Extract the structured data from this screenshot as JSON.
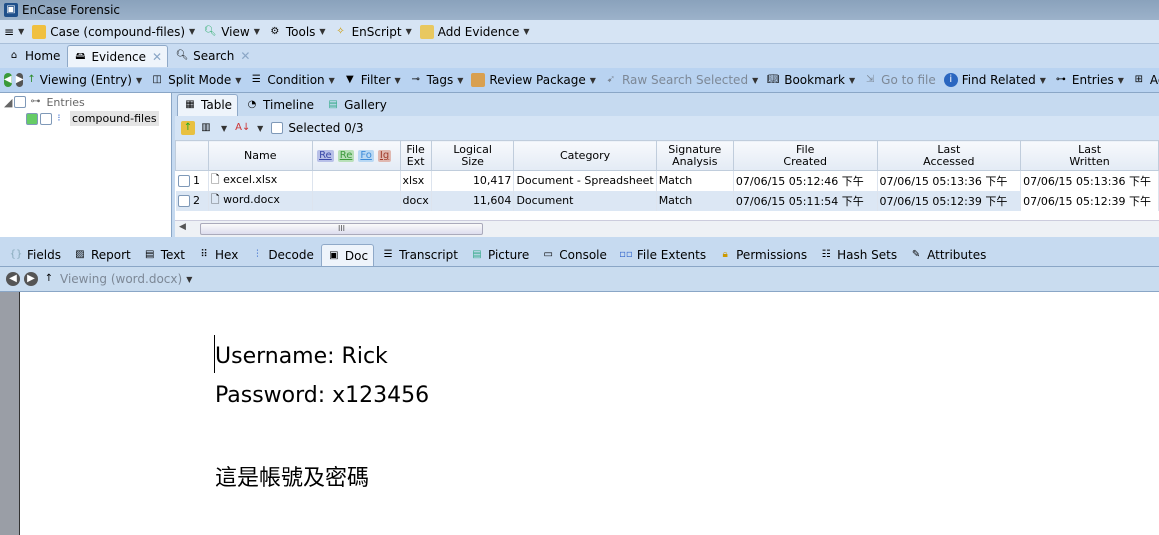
{
  "window": {
    "title": "EnCase Forensic"
  },
  "menu": [
    {
      "label": "Case (compound-files)",
      "icon": "folder-icon"
    },
    {
      "label": "View",
      "icon": "view-icon"
    },
    {
      "label": "Tools",
      "icon": "gear-icon"
    },
    {
      "label": "EnScript",
      "icon": "enscript-icon"
    },
    {
      "label": "Add Evidence",
      "icon": "add-evidence-icon"
    }
  ],
  "tabs": [
    {
      "label": "Home",
      "closable": false
    },
    {
      "label": "Evidence",
      "closable": true,
      "active": true
    },
    {
      "label": "Search",
      "closable": true
    }
  ],
  "toolbar": [
    "Viewing (Entry)",
    "Split Mode",
    "Condition",
    "Filter",
    "Tags",
    "Review Package",
    "Raw Search Selected",
    "Bookmark",
    "Go to file",
    "Find Related",
    "Entries",
    "Ac"
  ],
  "tree": {
    "root": "Entries",
    "child": "compound-files"
  },
  "subtabs": [
    "Table",
    "Timeline",
    "Gallery"
  ],
  "table_toolbar": {
    "selected": "Selected 0/3"
  },
  "table": {
    "tag_columns": [
      {
        "label": "Re",
        "color": "#3a49a8"
      },
      {
        "label": "Re",
        "color": "#3c9a3c"
      },
      {
        "label": "Fo",
        "color": "#3d8bd8"
      },
      {
        "label": "Ig",
        "color": "#a03a2a"
      }
    ],
    "headers": [
      "Name",
      "File Ext",
      "Logical Size",
      "Category",
      "Signature Analysis",
      "File Created",
      "Last Accessed",
      "Last Written"
    ],
    "header_lines": [
      [
        "Name"
      ],
      [
        "File",
        "Ext"
      ],
      [
        "Logical",
        "Size"
      ],
      [
        "Category"
      ],
      [
        "Signature",
        "Analysis"
      ],
      [
        "File",
        "Created"
      ],
      [
        "Last",
        "Accessed"
      ],
      [
        "Last",
        "Written"
      ]
    ],
    "rows": [
      {
        "num": "1",
        "name": "excel.xlsx",
        "ext": "xlsx",
        "size": "10,417",
        "category": "Document - Spreadsheet",
        "signature": "Match",
        "created": "07/06/15 05:12:46 下午",
        "accessed": "07/06/15 05:13:36 下午",
        "written": "07/06/15 05:13:36 下午"
      },
      {
        "num": "2",
        "name": "word.docx",
        "ext": "docx",
        "size": "11,604",
        "category": "Document",
        "signature": "Match",
        "created": "07/06/15 05:11:54 下午",
        "accessed": "07/06/15 05:12:39 下午",
        "written": "07/06/15 05:12:39 下午",
        "selected": true
      }
    ],
    "scroll_grip": "III"
  },
  "bottom_tabs": [
    "Fields",
    "Report",
    "Text",
    "Hex",
    "Decode",
    "Doc",
    "Transcript",
    "Picture",
    "Console",
    "File Extents",
    "Permissions",
    "Hash Sets",
    "Attributes"
  ],
  "bottom_active": "Doc",
  "viewing": "Viewing (word.docx)",
  "document": {
    "lines": [
      "Username: Rick",
      "Password: x123456",
      "這是帳號及密碼"
    ]
  }
}
